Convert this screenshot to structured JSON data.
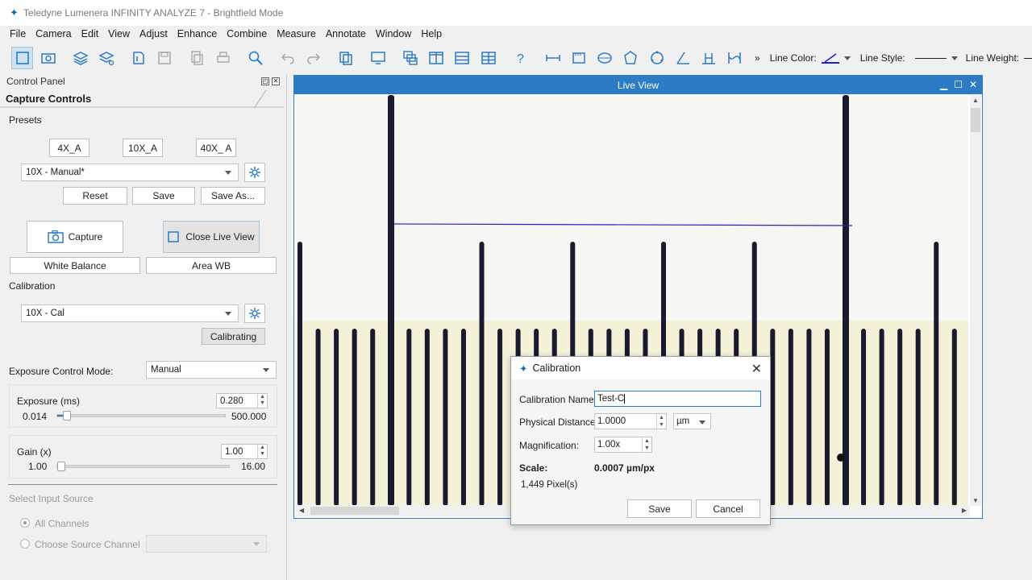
{
  "window": {
    "title": "Teledyne Lumenera INFINITY ANALYZE 7 - Brightfield Mode"
  },
  "menu": [
    "File",
    "Camera",
    "Edit",
    "View",
    "Adjust",
    "Enhance",
    "Combine",
    "Measure",
    "Annotate",
    "Window",
    "Help"
  ],
  "toolbar": {
    "line_color_label": "Line Color:",
    "line_style_label": "Line Style:",
    "line_weight_label": "Line Weight:",
    "more": "»"
  },
  "control_panel": {
    "title": "Control Panel",
    "section_title": "Capture Controls",
    "presets_label": "Presets",
    "preset_buttons": [
      "4X_A",
      "10X_A",
      "40X_ A"
    ],
    "preset_selected": "10X - Manual*",
    "reset_label": "Reset",
    "save_label": "Save",
    "save_as_label": "Save As...",
    "capture_label": "Capture",
    "close_live_label": "Close Live View",
    "white_balance_label": "White Balance",
    "area_wb_label": "Area WB",
    "calibration_label": "Calibration",
    "calibration_selected": "10X - Cal",
    "calibrating_label": "Calibrating",
    "exposure_mode_label": "Exposure Control Mode:",
    "exposure_mode_value": "Manual",
    "exposure": {
      "label": "Exposure (ms)",
      "value": "0.280",
      "min": "0.014",
      "max": "500.000",
      "position": 0.02
    },
    "gain": {
      "label": "Gain (x)",
      "value": "1.00",
      "min": "1.00",
      "max": "16.00",
      "position": 0.0
    },
    "input_source_label": "Select Input Source",
    "all_channels_label": "All Channels",
    "choose_source_label": "Choose Source Channel"
  },
  "live_view": {
    "title": "Live View"
  },
  "calibration_dialog": {
    "title": "Calibration",
    "name_label": "Calibration Name:",
    "name_value": "Test-C",
    "distance_label": "Physical Distance:",
    "distance_value": "1.0000",
    "unit": "µm",
    "magnification_label": "Magnification:",
    "magnification_value": "1.00x",
    "scale_label": "Scale:",
    "scale_value": "0.0007 µm/px",
    "pixels": "1,449 Pixel(s)",
    "save_label": "Save",
    "cancel_label": "Cancel"
  },
  "colors": {
    "accent": "#2d7bc4",
    "line_color": "#1d1dd0",
    "ruler_line": "#1a1a2e"
  }
}
